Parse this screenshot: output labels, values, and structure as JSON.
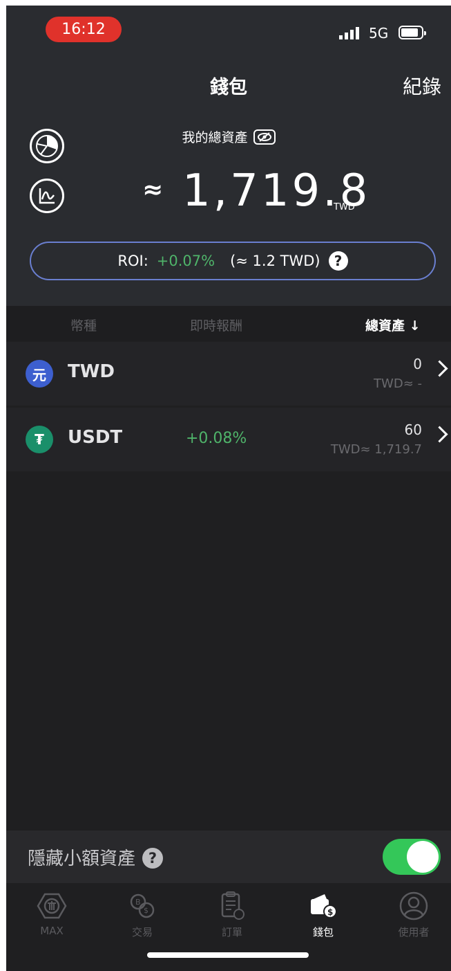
{
  "status_bar": {
    "time": "16:12",
    "network": "5G"
  },
  "nav": {
    "title": "錢包",
    "right_action": "紀錄"
  },
  "summary": {
    "label": "我的總資產",
    "approx_symbol": "≈",
    "amount": "1,719.8",
    "unit": "TWD",
    "roi_label": "ROI:",
    "roi_percent": "+0.07%",
    "roi_value": "(≈ 1.2 TWD)"
  },
  "table": {
    "headers": {
      "currency": "幣種",
      "realtime_return": "即時報酬",
      "total_assets": "總資產 ↓"
    },
    "rows": [
      {
        "icon_text": "元",
        "icon_color": "#3d5fcf",
        "symbol": "TWD",
        "roi": "",
        "amount": "0",
        "twd_value": "TWD≈ -"
      },
      {
        "icon_text": "₮",
        "icon_color": "#1a8f6a",
        "symbol": "USDT",
        "roi": "+0.08%",
        "amount": "60",
        "twd_value": "TWD≈ 1,719.7"
      }
    ]
  },
  "hide_small": {
    "label": "隱藏小額資產",
    "enabled": true
  },
  "tabbar": {
    "items": [
      {
        "label": "MAX",
        "icon": "max-logo-icon",
        "active": false
      },
      {
        "label": "交易",
        "icon": "exchange-icon",
        "active": false
      },
      {
        "label": "訂單",
        "icon": "orders-icon",
        "active": false
      },
      {
        "label": "錢包",
        "icon": "wallet-icon",
        "active": true
      },
      {
        "label": "使用者",
        "icon": "user-icon",
        "active": false
      }
    ]
  },
  "colors": {
    "background": "#1f1f21",
    "header": "#2a2c30",
    "positive": "#4fb46a",
    "accent_border": "#6a7fd0",
    "toggle_on": "#34c759"
  }
}
